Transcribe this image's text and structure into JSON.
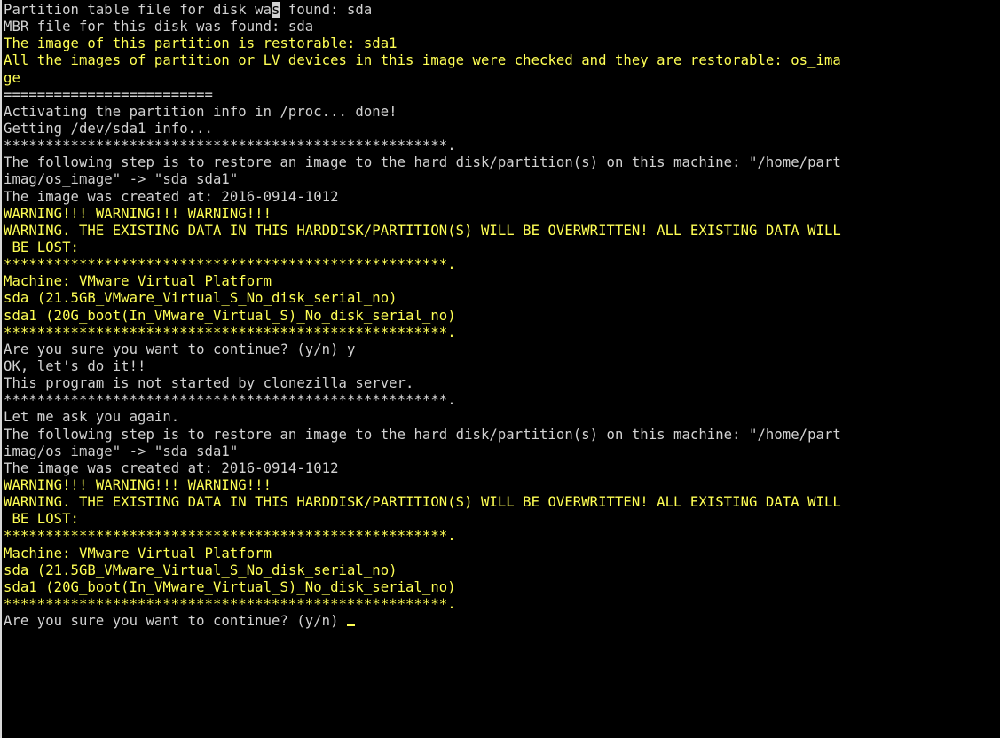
{
  "terminal": {
    "line0": {
      "before": "Partition table file for disk wa",
      "cursor": "s",
      "after": " found: sda"
    },
    "lines": [
      {
        "text": "MBR file for this disk was found: sda",
        "color": "white"
      },
      {
        "text": "The image of this partition is restorable: sda1",
        "color": "yellow"
      },
      {
        "text": "All the images of partition or LV devices in this image were checked and they are restorable: os_ima",
        "color": "yellow"
      },
      {
        "text": "ge",
        "color": "yellow"
      },
      {
        "text": "=========================",
        "color": "white"
      },
      {
        "text": "Activating the partition info in /proc... done!",
        "color": "white"
      },
      {
        "text": "Getting /dev/sda1 info...",
        "color": "white"
      },
      {
        "text": "*****************************************************.",
        "color": "white"
      },
      {
        "text": "The following step is to restore an image to the hard disk/partition(s) on this machine: \"/home/part",
        "color": "white"
      },
      {
        "text": "imag/os_image\" -> \"sda sda1\"",
        "color": "white"
      },
      {
        "text": "The image was created at: 2016-0914-1012",
        "color": "white"
      },
      {
        "text": "WARNING!!! WARNING!!! WARNING!!!",
        "color": "yellow"
      },
      {
        "text": "WARNING. THE EXISTING DATA IN THIS HARDDISK/PARTITION(S) WILL BE OVERWRITTEN! ALL EXISTING DATA WILL",
        "color": "yellow"
      },
      {
        "text": " BE LOST:",
        "color": "yellow"
      },
      {
        "text": "*****************************************************.",
        "color": "yellow"
      },
      {
        "text": "Machine: VMware Virtual Platform",
        "color": "yellow"
      },
      {
        "text": "sda (21.5GB_VMware_Virtual_S_No_disk_serial_no)",
        "color": "yellow"
      },
      {
        "text": "sda1 (20G_boot(In_VMware_Virtual_S)_No_disk_serial_no)",
        "color": "yellow"
      },
      {
        "text": "*****************************************************.",
        "color": "yellow"
      },
      {
        "text": "Are you sure you want to continue? (y/n) y",
        "color": "white"
      },
      {
        "text": "OK, let's do it!!",
        "color": "white"
      },
      {
        "text": "This program is not started by clonezilla server.",
        "color": "white"
      },
      {
        "text": "*****************************************************.",
        "color": "white"
      },
      {
        "text": "Let me ask you again.",
        "color": "white"
      },
      {
        "text": "The following step is to restore an image to the hard disk/partition(s) on this machine: \"/home/part",
        "color": "white"
      },
      {
        "text": "imag/os_image\" -> \"sda sda1\"",
        "color": "white"
      },
      {
        "text": "The image was created at: 2016-0914-1012",
        "color": "white"
      },
      {
        "text": "WARNING!!! WARNING!!! WARNING!!!",
        "color": "yellow"
      },
      {
        "text": "WARNING. THE EXISTING DATA IN THIS HARDDISK/PARTITION(S) WILL BE OVERWRITTEN! ALL EXISTING DATA WILL",
        "color": "yellow"
      },
      {
        "text": " BE LOST:",
        "color": "yellow"
      },
      {
        "text": "*****************************************************.",
        "color": "yellow"
      },
      {
        "text": "Machine: VMware Virtual Platform",
        "color": "yellow"
      },
      {
        "text": "sda (21.5GB_VMware_Virtual_S_No_disk_serial_no)",
        "color": "yellow"
      },
      {
        "text": "sda1 (20G_boot(In_VMware_Virtual_S)_No_disk_serial_no)",
        "color": "yellow"
      },
      {
        "text": "*****************************************************.",
        "color": "yellow"
      }
    ],
    "prompt": "Are you sure you want to continue? (y/n) ",
    "colors": {
      "background": "#000000",
      "text": "#d2d2d2",
      "highlight": "#ffff54"
    }
  }
}
